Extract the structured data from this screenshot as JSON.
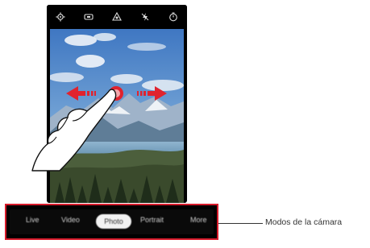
{
  "status_icons": [
    {
      "icon": "settings-icon"
    },
    {
      "icon": "aspect-ratio-icon"
    },
    {
      "icon": "filter-icon"
    },
    {
      "icon": "flash-off-icon"
    },
    {
      "icon": "timer-icon"
    }
  ],
  "modes": {
    "items": [
      "Live",
      "Video",
      "Photo",
      "Portrait",
      "More"
    ],
    "selected": "Photo"
  },
  "callout": {
    "label": "Modos de la cámara"
  },
  "colors": {
    "accent": "#d61b2b",
    "arrow": "#e0232e"
  },
  "gesture": {
    "description_icon": "swipe-hand-icon",
    "arrows": [
      "arrow-left-icon",
      "arrow-right-icon"
    ]
  }
}
